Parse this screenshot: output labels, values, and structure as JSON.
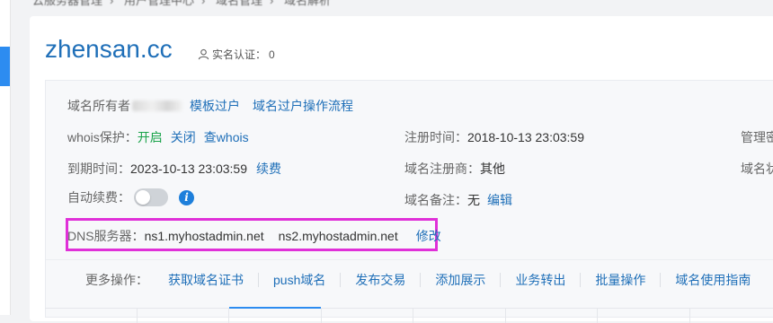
{
  "breadcrumb": [
    "云服务器管理",
    "用户管理中心",
    "域名管理",
    "域名解析"
  ],
  "domain": "zhensan.cc",
  "realname": {
    "label": "实名认证：",
    "value": "0"
  },
  "owner": {
    "label": "域名所有者",
    "links": [
      "模板过户",
      "域名过户操作流程"
    ]
  },
  "whois": {
    "label": "whois保护：",
    "on": "开启",
    "off": "关闭",
    "view": "查whois"
  },
  "register_time": {
    "label": "注册时间：",
    "value": "2018-10-13 23:03:59"
  },
  "admin_partial": "管理密",
  "expire_time": {
    "label": "到期时间：",
    "value": "2023-10-13 23:03:59",
    "renew": "续费"
  },
  "registrar": {
    "label": "域名注册商：",
    "value": "其他"
  },
  "domain_partial": "域名状",
  "autorenew": {
    "label": "自动续费：",
    "enabled": false
  },
  "remark": {
    "label": "域名备注：",
    "value": "无",
    "edit": "编辑"
  },
  "dns": {
    "label": "DNS服务器：",
    "ns1": "ns1.myhostadmin.net",
    "ns2": "ns2.myhostadmin.net",
    "modify": "修改"
  },
  "more": {
    "label": "更多操作：",
    "items": [
      "获取域名证书",
      "push域名",
      "发布交易",
      "添加展示",
      "业务转出",
      "批量操作",
      "域名使用指南"
    ]
  },
  "colors": {
    "accent": "#1f6fb8",
    "highlight": "#e030d8",
    "green": "#1aa34a"
  }
}
